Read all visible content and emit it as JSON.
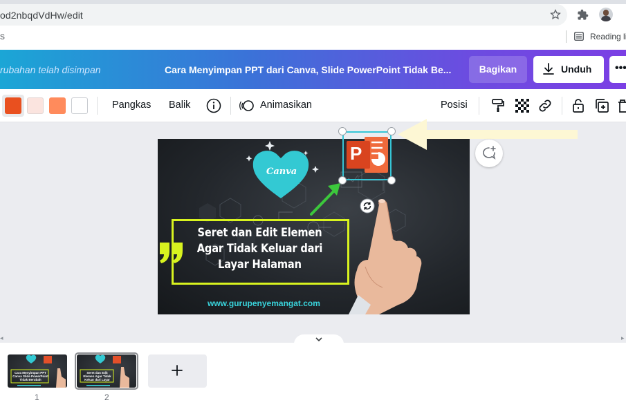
{
  "browser": {
    "url": "od2nbqdVdHw/edit",
    "more_glyph": "⋮",
    "bookmark_dots": "s",
    "reading_list_label": "Reading li"
  },
  "header": {
    "saved_status": "rubahan telah disimpan",
    "doc_title": "Cara Menyimpan PPT dari Canva, Slide PowerPoint Tidak Be...",
    "share_label": "Bagikan",
    "download_label": "Unduh",
    "more_label": "•••"
  },
  "toolbar": {
    "colors": [
      "#e9501f",
      "#fbe4df",
      "#ff8b5c",
      "#ffffff"
    ],
    "crop_label": "Pangkas",
    "flip_label": "Balik",
    "animate_label": "Animasikan",
    "position_label": "Posisi"
  },
  "slide": {
    "logo_text": "Canva",
    "headline_lines": [
      "Seret dan Edit Elemen",
      "Agar Tidak Keluar dari",
      "Layar Halaman"
    ],
    "website": "www.gurupenyemangat.com",
    "ppt_letter": "P"
  },
  "pages": {
    "items": [
      {
        "number": "1",
        "caption": "Cara Menyimpan PPT Canva Slide PowerPoint Tidak Berubah"
      },
      {
        "number": "2",
        "caption": "Seret dan Edit Elemen Agar Tidak Keluar dari Layar Halaman"
      }
    ],
    "add_label": "+"
  },
  "colors": {
    "accent_cyan": "#36c5d6",
    "highlight_yellow": "#d8f31f",
    "ppt_orange": "#e4502a",
    "arrow_green": "#3cc83c"
  }
}
